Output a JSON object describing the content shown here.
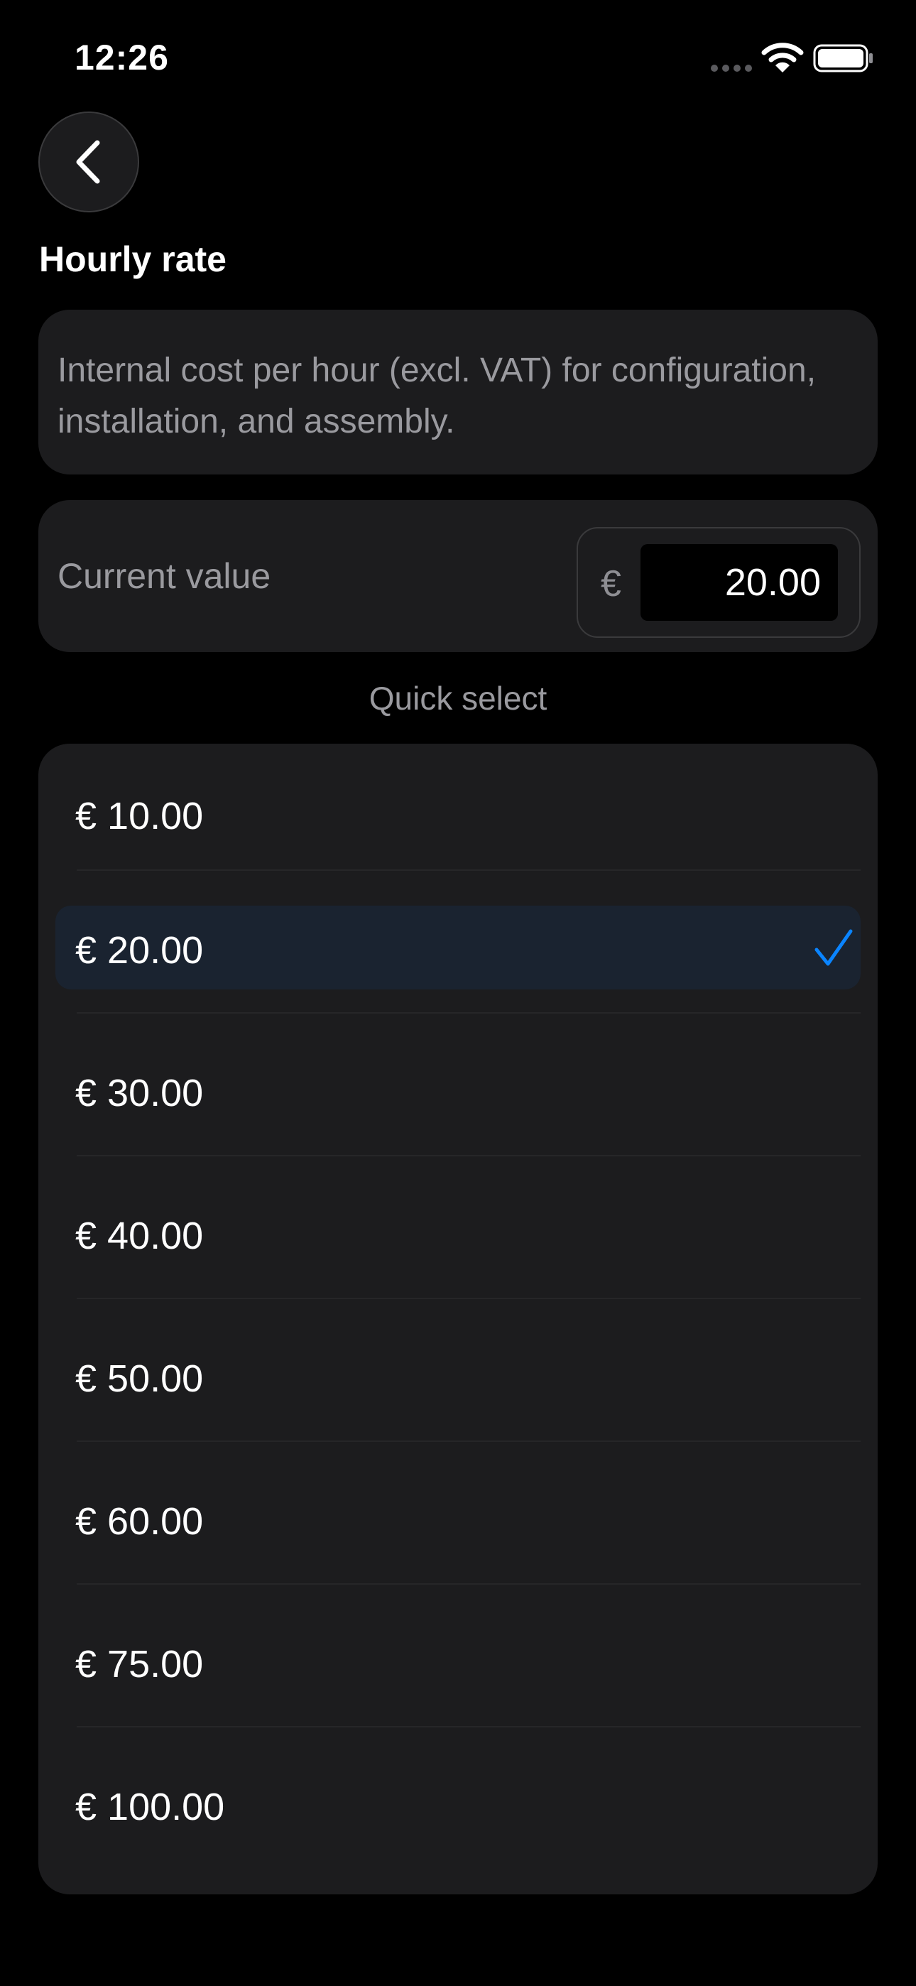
{
  "status_bar": {
    "time": "12:26"
  },
  "header": {
    "title": "Hourly rate"
  },
  "description": "Internal cost per hour (excl. VAT) for configuration, installation, and assembly.",
  "current_value": {
    "label": "Current value",
    "currency": "€",
    "value": "20.00"
  },
  "quick_select": {
    "label": "Quick select",
    "options": [
      {
        "label": "€ 10.00",
        "selected": false
      },
      {
        "label": "€ 20.00",
        "selected": true
      },
      {
        "label": "€ 30.00",
        "selected": false
      },
      {
        "label": "€ 40.00",
        "selected": false
      },
      {
        "label": "€ 50.00",
        "selected": false
      },
      {
        "label": "€ 60.00",
        "selected": false
      },
      {
        "label": "€ 75.00",
        "selected": false
      },
      {
        "label": "€ 100.00",
        "selected": false
      }
    ]
  },
  "colors": {
    "accent": "#0a84ff",
    "background": "#000000",
    "card": "#1c1c1e",
    "selected_row": "#1a2330"
  },
  "icons": {
    "back": "chevron-left-icon",
    "check": "checkmark-icon",
    "wifi": "wifi-icon",
    "battery": "battery-icon",
    "signal": "signal-dots-icon"
  }
}
